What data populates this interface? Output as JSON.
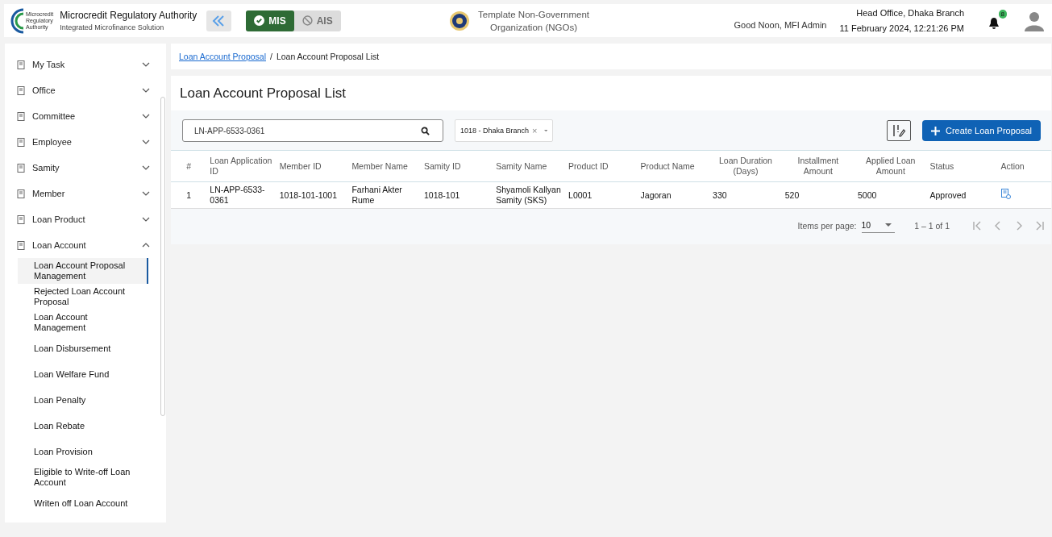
{
  "header": {
    "org_name": "Microcredit Regulatory Authority",
    "org_subtitle": "Integrated Microfinance Solution",
    "logo_text": [
      "Microcredit",
      "Regulatory",
      "Authority"
    ],
    "modules": [
      {
        "label": "MIS",
        "selected": true
      },
      {
        "label": "AIS",
        "selected": false
      }
    ],
    "ngo_name": [
      "Template Non-Government",
      "Organization (NGOs)"
    ],
    "greeting": "Good Noon, MFI Admin",
    "branch": "Head Office, Dhaka Branch",
    "datetime": "11 February 2024, 12:21:26 PM",
    "notification_count": "8"
  },
  "sidebar": {
    "items": [
      {
        "label": "My Task",
        "expanded": false
      },
      {
        "label": "Office",
        "expanded": false
      },
      {
        "label": "Committee",
        "expanded": false
      },
      {
        "label": "Employee",
        "expanded": false
      },
      {
        "label": "Samity",
        "expanded": false
      },
      {
        "label": "Member",
        "expanded": false
      },
      {
        "label": "Loan Product",
        "expanded": false
      },
      {
        "label": "Loan Account",
        "expanded": true,
        "children": [
          {
            "label": "Loan Account Proposal Management",
            "selected": true
          },
          {
            "label": "Rejected Loan Account Proposal",
            "selected": false
          },
          {
            "label": "Loan Account Management",
            "selected": false
          },
          {
            "label": "Loan Disbursement",
            "selected": false
          },
          {
            "label": "Loan Welfare Fund",
            "selected": false
          },
          {
            "label": "Loan Penalty",
            "selected": false
          },
          {
            "label": "Loan Rebate",
            "selected": false
          },
          {
            "label": "Loan Provision",
            "selected": false
          },
          {
            "label": "Eligible to Write-off Loan Account",
            "selected": false
          },
          {
            "label": "Writen off Loan Account",
            "selected": false
          }
        ]
      }
    ]
  },
  "breadcrumb_separator": "/",
  "breadcrumb": [
    {
      "label": "Loan Account Proposal",
      "link": true
    },
    {
      "label": "Loan Account Proposal List",
      "link": false
    }
  ],
  "page_title": "Loan Account Proposal List",
  "search": {
    "value": "LN-APP-6533-0361"
  },
  "branch_select": {
    "value": "1018 - Dhaka Branch",
    "clear": "×"
  },
  "create_button": "Create Loan Proposal",
  "table": {
    "columns": [
      "#",
      "Loan Application ID",
      "Member ID",
      "Member Name",
      "Samity ID",
      "Samity Name",
      "Product ID",
      "Product Name",
      "Loan Duration (Days)",
      "Installment Amount",
      "Applied Loan Amount",
      "Status",
      "Action"
    ],
    "rows": [
      {
        "cells": [
          "1",
          "LN-APP-6533-0361",
          "1018-101-1001",
          "Farhani Akter Rume",
          "1018-101",
          "Shyamoli Kallyan Samity (SKS)",
          "L0001",
          "Jagoran",
          "330",
          "520",
          "5000",
          "Approved"
        ]
      }
    ]
  },
  "pagination": {
    "label": "Items per page:",
    "page_size": "10",
    "range": "1 – 1 of 1"
  }
}
